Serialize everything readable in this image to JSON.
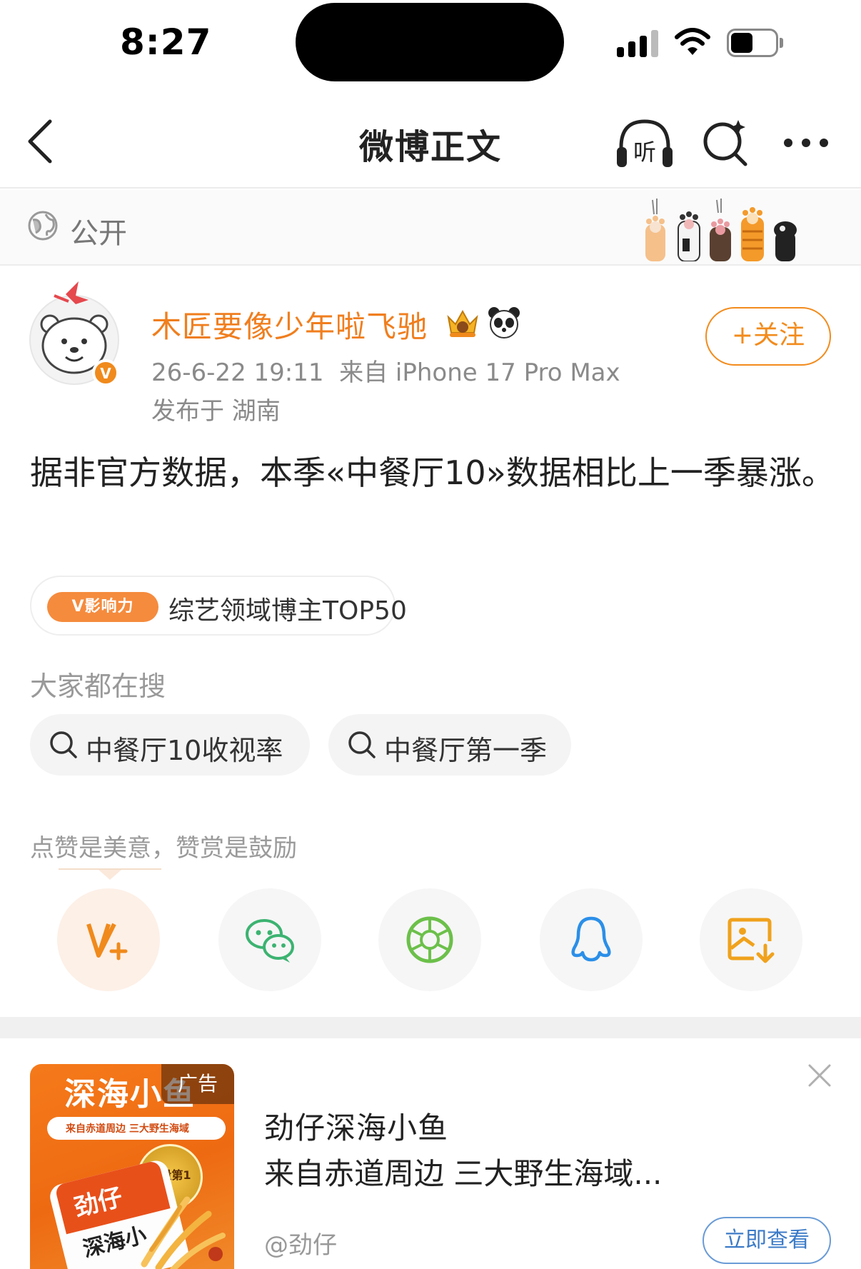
{
  "status_bar": {
    "time": "8:27"
  },
  "nav": {
    "title": "微博正文",
    "back_icon": "chevron-left-icon",
    "listen_label": "听"
  },
  "visibility": {
    "label": "公开"
  },
  "post": {
    "user_name": "木匠要像少年啦飞驰",
    "timestamp": "26-6-22 19:11",
    "source": "来自 iPhone 17 Pro Max",
    "location": "发布于 湖南",
    "follow_label": "+关注",
    "text": "据非官方数据，本季«中餐厅10»数据相比上一季暴涨。",
    "influence_tag": "V影响力",
    "influence_text": "综艺领域博主TOP50"
  },
  "trending": {
    "title": "大家都在搜",
    "items": [
      {
        "label": "中餐厅10收视率"
      },
      {
        "label": "中餐厅第一季"
      }
    ]
  },
  "reward": {
    "hint": "点赞是美意，赞赏是鼓励",
    "share_targets": [
      "reward-icon",
      "wechat-icon",
      "moments-icon",
      "qq-icon",
      "save-image-icon"
    ]
  },
  "ad": {
    "image_title": "深海小鱼",
    "tag": "广告",
    "ribbon_text": "来自赤道周边 三大野生海域",
    "medal_text": "销量第1",
    "pack_brand": "劲仔",
    "pack_sub": "深海小",
    "title": "劲仔深海小鱼",
    "subtitle": "来自赤道周边 三大野生海域...",
    "source": "@劲仔",
    "cta_label": "立即查看"
  },
  "colors": {
    "accent_orange": "#f07e1e",
    "follow_orange": "#f28b1c",
    "cta_blue": "#3c7bc7",
    "wechat_green": "#3cb371",
    "qq_blue": "#2b8fe8"
  }
}
